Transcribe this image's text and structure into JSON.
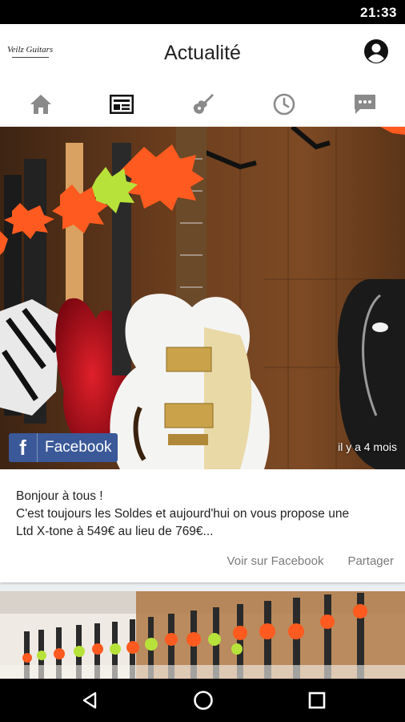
{
  "status_bar": {
    "time": "21:33"
  },
  "app_bar": {
    "logo_text": "Veilz Guitars",
    "title": "Actualité"
  },
  "tabs": [
    {
      "icon": "home-icon"
    },
    {
      "icon": "news-icon",
      "active": true
    },
    {
      "icon": "guitar-icon"
    },
    {
      "icon": "clock-icon"
    },
    {
      "icon": "chat-icon"
    }
  ],
  "post": {
    "source_label": "Facebook",
    "time_ago": "il y a 4 mois",
    "lines": [
      "Bonjour à tous !",
      "C'est toujours les Soldes et aujourd'hui on vous propose une",
      "Ltd X-tone à 549€ au lieu de 769€..."
    ],
    "actions": {
      "view_on_facebook": "Voir sur Facebook",
      "share": "Partager"
    }
  },
  "colors": {
    "facebook": "#3b5998",
    "active_tab": "#111111",
    "inactive_tab": "#8a8a8a",
    "sale_tag_red": "#ff5a1f",
    "sale_tag_green": "#b7e23a"
  },
  "nav_bar": {
    "back": "back-icon",
    "home": "home-circle-icon",
    "recents": "recents-icon"
  }
}
